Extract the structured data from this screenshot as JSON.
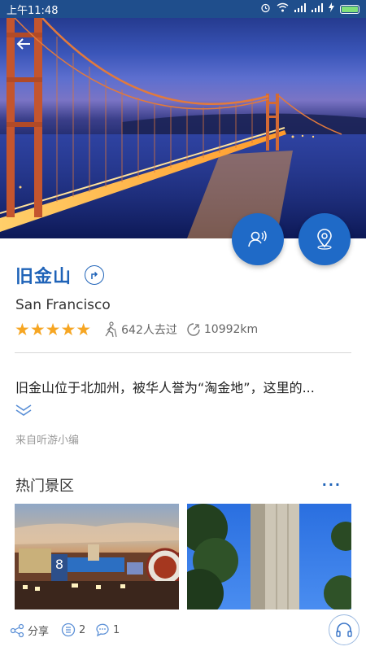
{
  "status_bar": {
    "time": "上午11:48",
    "icons": [
      "alarm-icon",
      "wifi-icon",
      "signal-icon",
      "signal-icon",
      "charging-icon",
      "battery-icon"
    ]
  },
  "hero": {
    "back_icon": "back-arrow-icon",
    "fab_guide_icon": "guide-person-icon",
    "fab_location_icon": "location-pin-icon"
  },
  "place": {
    "name": "旧金山",
    "english_name": "San Francisco",
    "rating_stars": 5,
    "stars_text": "★★★★★",
    "visitors": "642人去过",
    "distance": "10992km",
    "description": "旧金山位于北加州，被华人誉为“淘金地”，这里的...",
    "source": "来自听游小编"
  },
  "section": {
    "title": "热门景区",
    "more_icon": "more-dots-icon",
    "more_text": "···"
  },
  "bottom_bar": {
    "share_label": "分享",
    "list_count": "2",
    "comment_count": "1",
    "audio_icon": "headphones-icon"
  },
  "colors": {
    "accent": "#1f63b8",
    "fab": "#1f6ac7",
    "star": "#f6a623",
    "statusbar": "#1f4e8c"
  }
}
